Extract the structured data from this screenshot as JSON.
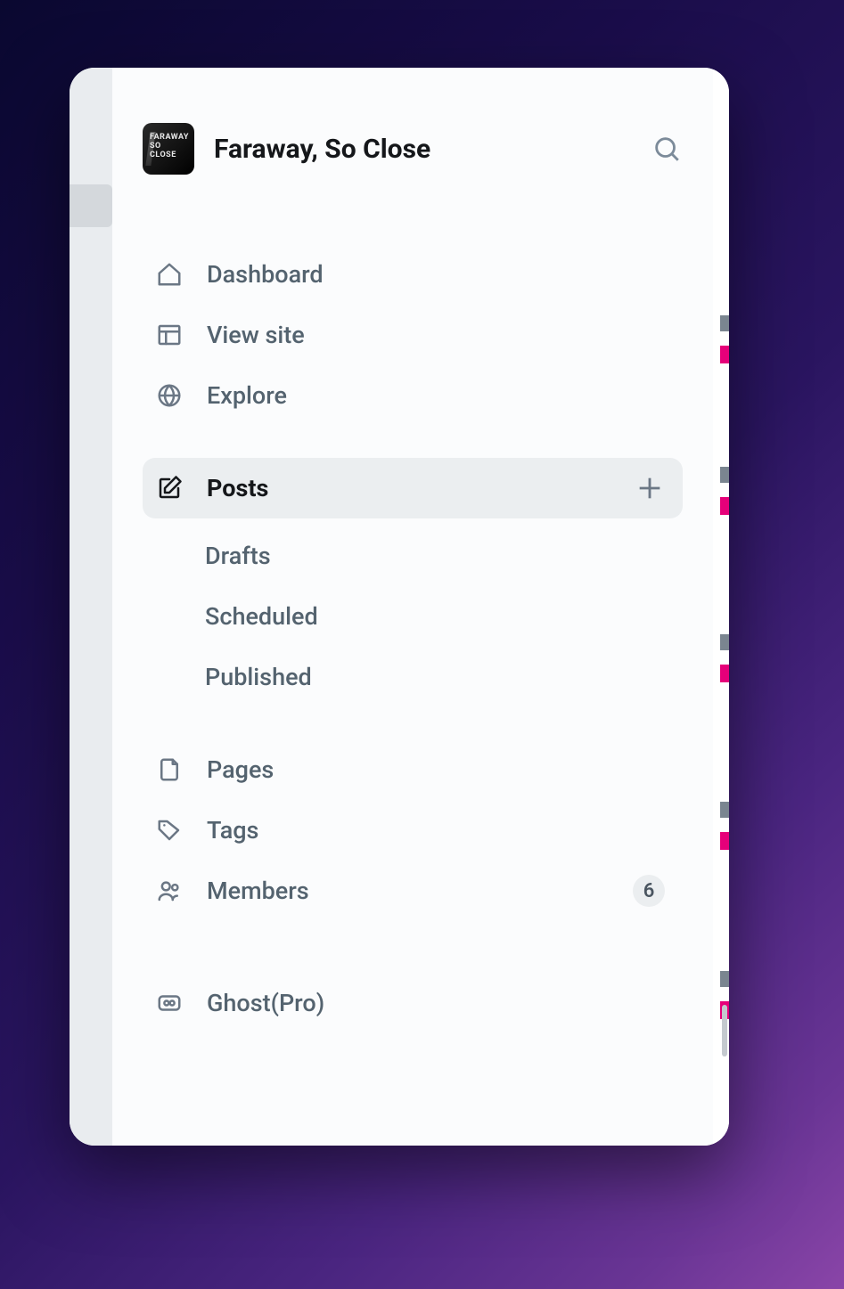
{
  "site": {
    "title": "Faraway, So Close",
    "icon_text": "FARAWAY\nSO\nCLOSE"
  },
  "nav": {
    "dashboard": "Dashboard",
    "view_site": "View site",
    "explore": "Explore",
    "posts": "Posts",
    "posts_sub": {
      "drafts": "Drafts",
      "scheduled": "Scheduled",
      "published": "Published"
    },
    "pages": "Pages",
    "tags": "Tags",
    "members": "Members",
    "members_count": "6",
    "ghost_pro": "Ghost(Pro)"
  }
}
